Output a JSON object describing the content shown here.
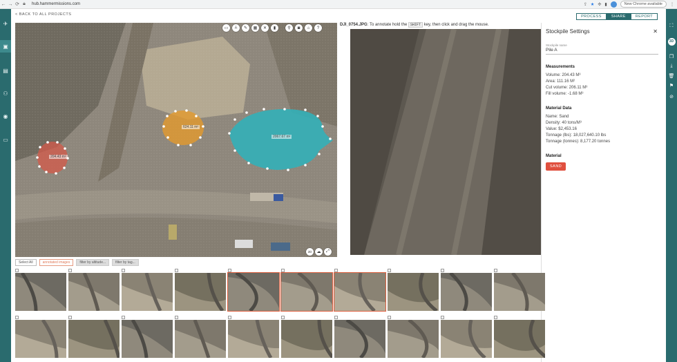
{
  "browser": {
    "url": "hub.hammermissions.com",
    "update_label": "New Chrome available"
  },
  "header": {
    "back_label": "< BACK TO ALL PROJECTS",
    "tabs": [
      {
        "label": "PROCESS",
        "active": false
      },
      {
        "label": "SHARE",
        "active": true
      },
      {
        "label": "REPORT",
        "active": false
      }
    ]
  },
  "map": {
    "piles": [
      {
        "label": "204.43 m²",
        "color": "#d45a4a"
      },
      {
        "label": "624.11 m²",
        "color": "#e39a2d"
      },
      {
        "label": "2067.67 m²",
        "color": "#33b0b8"
      }
    ],
    "bottom_tools": [
      "2D",
      "cloud-icon",
      "expand-icon"
    ]
  },
  "photo": {
    "filename": "DJI_0754.JPG",
    "instruction_pre": "To annotate hold the",
    "key": "SHIFT",
    "instruction_post": "key, then click and drag the mouse."
  },
  "panel": {
    "title": "Stockpile Settings",
    "name_label": "Stockpile name",
    "name_value": "Pile A",
    "measurements_title": "Measurements",
    "measurements": [
      "Volume: 204.43 M³",
      "Area: 111.16 M²",
      "Cut volume: 206.11 M³",
      "Fill volume: -1.68 M³"
    ],
    "material_data_title": "Material Data",
    "material_data": [
      "Name: Sand",
      "Density: 40 tons/M³",
      "Value: $2,453.16",
      "Tonnage (lbs): 18,027,640.10 lbs",
      "Tonnage (tonnes): 8,177.20 tonnes"
    ],
    "material_title": "Material",
    "material_button": "SAND",
    "accent": "#e0503f"
  },
  "filters": {
    "select_all": "Select All",
    "annotated": "annotated images",
    "by_altitude": "filter by altitude...",
    "by_tag": "filter by tag..."
  },
  "colors": {
    "rail": "#2a6b6e",
    "selected_outline": "#e0603f"
  }
}
